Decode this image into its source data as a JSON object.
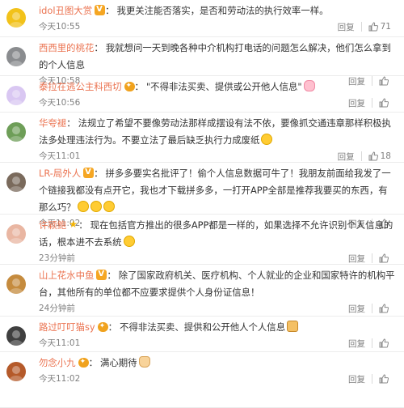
{
  "labels": {
    "reply": "回复"
  },
  "comments": [
    {
      "username": "idol丑图大赏",
      "badge": "vip",
      "text": "我更关注能否落实，是否和劳动法的执行效率一样。",
      "emojis": [],
      "time": "今天10:55",
      "likes": "71",
      "avatar_color": "#f2c21a"
    },
    {
      "username": "西西里的桃花",
      "badge": "",
      "text": "我就想问一天到晚各种中介机构打电话的问题怎么解决，他们怎么拿到的个人信息",
      "emojis": [],
      "time": "今天10:58",
      "likes": "",
      "avatar_color": "#8a8c8f"
    },
    {
      "username": "泰拉在逃公主科西切",
      "badge": "crown",
      "text": "\"不得非法买卖、提供或公开他人信息\"",
      "emojis": [
        "pink"
      ],
      "time": "今天10:56",
      "likes": "",
      "avatar_color": "#d9c7f2"
    },
    {
      "username": "华夸褪",
      "badge": "",
      "text": "法规立了希望不要像劳动法那样成摆设有法不依，要像抓交通违章那样积极执法多处理违法行为。不要立法了最后缺乏执行力成废纸",
      "emojis": [
        "smile"
      ],
      "time": "今天11:01",
      "likes": "18",
      "avatar_color": "#6e9e58"
    },
    {
      "username": "LR-局外人",
      "badge": "vip",
      "text": "拼多多要实名批评了！偷个人信息数据可牛了！我朋友前面给我发了一个链接我都没有点开它，我也才下载拼多多，一打开APP全部是推荐我要买的东西，有那么巧？",
      "emojis": [
        "smile",
        "smile",
        "smile"
      ],
      "time": "今天11:02",
      "likes": "",
      "avatar_color": "#7a6a5c"
    },
    {
      "username": "许颖鲍",
      "badge": "star",
      "text": "现在包括官方推出的很多APP都是一样的，如果选择不允许识别个人信息的话，根本进不去系统",
      "emojis": [
        "smile"
      ],
      "time": "23分钟前",
      "likes": "",
      "avatar_color": "#e9b6a2"
    },
    {
      "username": "山上花水中鱼",
      "badge": "vip",
      "text": "除了国家政府机关、医疗机构、个人就业的企业和国家特许的机构平台，其他所有的单位都不应要求提供个人身份证信息！",
      "emojis": [],
      "time": "24分钟前",
      "likes": "",
      "avatar_color": "#c58b3e"
    },
    {
      "username": "路过叮叮猫sy",
      "badge": "crown",
      "text": "不得非法买卖、提供和公开他人个人信息",
      "emojis": [
        "bread"
      ],
      "time": "今天11:01",
      "likes": "",
      "avatar_color": "#3f3f3f"
    },
    {
      "username": "勿念小九",
      "badge": "crown",
      "text": "满心期待",
      "emojis": [
        "hand"
      ],
      "time": "今天11:02",
      "likes": "",
      "avatar_color": "#b55a2a"
    }
  ]
}
